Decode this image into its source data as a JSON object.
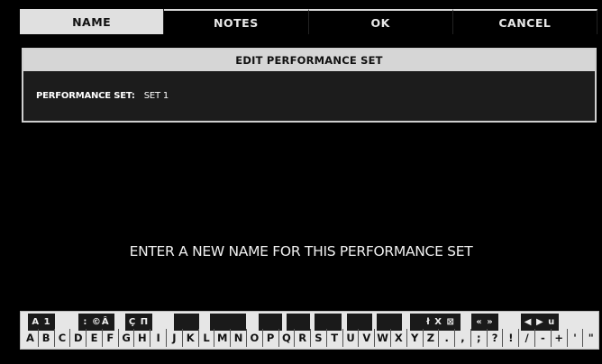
{
  "tabs": [
    {
      "label": "NAME",
      "active": true
    },
    {
      "label": "NOTES",
      "active": false
    },
    {
      "label": "OK",
      "active": false
    },
    {
      "label": "CANCEL",
      "active": false
    }
  ],
  "panel": {
    "title": "EDIT PERFORMANCE SET",
    "field_label": "PERFORMANCE SET:",
    "field_value": "SET 1"
  },
  "prompt": "ENTER A NEW NAME FOR THIS PERFORMANCE SET",
  "keyboard": {
    "black_keys": [
      {
        "label": "A 1"
      },
      {
        "label": ": ©Â"
      },
      {
        "label": "Ç П"
      },
      {
        "label": ""
      },
      {
        "label": ""
      },
      {
        "label": ""
      },
      {
        "label": ""
      },
      {
        "label": ""
      },
      {
        "label": ""
      },
      {
        "label": ""
      },
      {
        "label": ""
      },
      {
        "label": ""
      },
      {
        "label": ""
      },
      {
        "label": "ł X ⊠"
      },
      {
        "label": "« »"
      },
      {
        "label": "◀ ▶ u"
      }
    ],
    "white_keys": [
      "A",
      "B",
      "C",
      "D",
      "E",
      "F",
      "G",
      "H",
      "I",
      "J",
      "K",
      "L",
      "M",
      "N",
      "O",
      "P",
      "Q",
      "R",
      "S",
      "T",
      "U",
      "V",
      "W",
      "X",
      "Y",
      "Z",
      ".",
      ",",
      ";",
      "?",
      "!",
      "/",
      "-",
      "+",
      "'",
      "\""
    ]
  }
}
